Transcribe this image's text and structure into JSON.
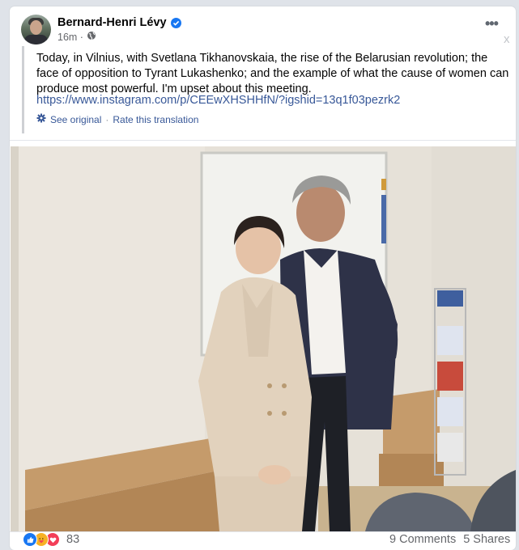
{
  "post": {
    "author": "Bernard-Henri Lévy",
    "time": "16m ·",
    "audience_icon": "globe-icon",
    "verified_icon": "verified-badge-icon",
    "more_label": "•••",
    "close_label": "x",
    "text": "Today, in Vilnius, with Svetlana Tikhanovskaia, the rise of the Belarusian revolution; the face of opposition to Tyrant Lukashenko; and the example of what the cause of women can produce most powerful. I'm upset about this meeting.",
    "link": "https://www.instagram.com/p/CEEwXHSHHfN/?igshid=13q1f03pezrk2",
    "translation": {
      "icon": "gear-icon",
      "see_original": "See original",
      "separator": "·",
      "rate": "Rate this translation"
    }
  },
  "footer": {
    "reaction_icons": [
      "like-icon",
      "care-icon",
      "love-icon"
    ],
    "reaction_count": "83",
    "comments": "9 Comments",
    "shares": "5 Shares"
  },
  "colors": {
    "link": "#385898",
    "verified": "#1877f2",
    "like": "#1877f2",
    "care": "#f7b125",
    "love": "#f33e58"
  }
}
